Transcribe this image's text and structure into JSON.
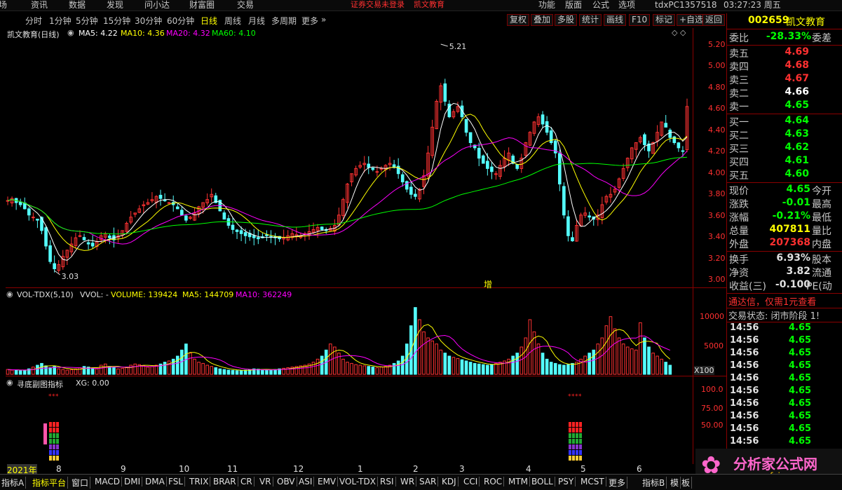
{
  "menu": {
    "items": [
      "场",
      "资讯",
      "数据",
      "发现",
      "问小达",
      "财富圈",
      "交易",
      "功能",
      "版面",
      "公式",
      "选项"
    ],
    "notice": "证券交易未登录",
    "stock_name": "凯文教育",
    "user": "tdxPC1357518",
    "time": "03:27:23 周五"
  },
  "toolbar": {
    "periods": [
      "分时",
      "1分钟",
      "5分钟",
      "15分钟",
      "30分钟",
      "60分钟",
      "日线",
      "周线",
      "月线",
      "多周期",
      "更多"
    ],
    "active": "日线",
    "more_arrow": "»",
    "right_buttons": [
      "复权",
      "叠加",
      "多股",
      "统计",
      "画线",
      "F10",
      "标记",
      "+自选",
      "返回"
    ]
  },
  "chart_header": {
    "title": "凯文教育(日线)",
    "ma5": "MA5: 4.22",
    "ma10": "MA10: 4.36",
    "ma20": "MA20: 4.32",
    "ma60": "MA60: 4.10",
    "high_label": "5.21",
    "low_label": "3.03",
    "center_mark": "增"
  },
  "price_axis": [
    "5.20",
    "5.00",
    "4.80",
    "4.60",
    "4.40",
    "4.20",
    "4.00",
    "3.80",
    "3.60",
    "3.40",
    "3.20",
    "3.00"
  ],
  "volume_header": {
    "title": "VOL-TDX(5,10)",
    "vvol": "VVOL: -",
    "volume": "VOLUME: 139424",
    "ma5": "MA5: 144709",
    "ma10": "MA10: 362249"
  },
  "volume_axis": [
    "10000",
    "5000",
    "X100"
  ],
  "indicator_header": {
    "title": "寻底副图指标",
    "xg": "XG: 0.00"
  },
  "indicator_axis": [
    "100.0",
    "75.00",
    "50.00"
  ],
  "dates": [
    "2021年",
    "8",
    "9",
    "10",
    "11",
    "12",
    "1",
    "2",
    "3",
    "4",
    "5",
    "6"
  ],
  "side": {
    "code": "002659",
    "name": "凯文教育",
    "weibi": {
      "label": "委比",
      "value": "-28.33%",
      "label2": "委差"
    },
    "asks": [
      {
        "label": "卖五",
        "price": "4.69"
      },
      {
        "label": "卖四",
        "price": "4.68"
      },
      {
        "label": "卖三",
        "price": "4.67"
      },
      {
        "label": "卖二",
        "price": "4.66"
      },
      {
        "label": "卖一",
        "price": "4.65"
      }
    ],
    "bids": [
      {
        "label": "买一",
        "price": "4.64"
      },
      {
        "label": "买二",
        "price": "4.63"
      },
      {
        "label": "买三",
        "price": "4.62"
      },
      {
        "label": "买四",
        "price": "4.61"
      },
      {
        "label": "买五",
        "price": "4.60"
      }
    ],
    "stats": [
      {
        "label": "现价",
        "value": "4.65",
        "label2": "今开",
        "color": "#00ff00"
      },
      {
        "label": "涨跌",
        "value": "-0.01",
        "label2": "最高",
        "color": "#00ff00"
      },
      {
        "label": "涨幅",
        "value": "-0.21%",
        "label2": "最低",
        "color": "#00ff00"
      },
      {
        "label": "总量",
        "value": "407811",
        "label2": "量比",
        "color": "#ffff00"
      },
      {
        "label": "外盘",
        "value": "207368",
        "label2": "内盘",
        "color": "#ff3030"
      }
    ],
    "stats2": [
      {
        "label": "换手",
        "value": "6.93%",
        "label2": "股本",
        "color": "#e0e0e0"
      },
      {
        "label": "净资",
        "value": "3.82",
        "label2": "流通",
        "color": "#e0e0e0"
      },
      {
        "label": "收益(三)",
        "value": "-0.100",
        "label2": "PE(动",
        "color": "#e0e0e0"
      }
    ],
    "promo": "通达信，仅需1元查看",
    "trade_status": "交易状态: 闭市阶段 1!",
    "ticks": [
      {
        "time": "14:56",
        "price": "4.65"
      },
      {
        "time": "14:56",
        "price": "4.65"
      },
      {
        "time": "14:56",
        "price": "4.65"
      },
      {
        "time": "14:56",
        "price": "4.65"
      },
      {
        "time": "14:56",
        "price": "4.65"
      },
      {
        "time": "14:56",
        "price": "4.65"
      },
      {
        "time": "14:56",
        "price": "4.65"
      },
      {
        "time": "14:56",
        "price": "4.65"
      },
      {
        "time": "14:56",
        "price": "4.65"
      },
      {
        "time": "14:56",
        "price": "4.65"
      }
    ]
  },
  "watermark": {
    "brand": "分析家公式网",
    "url": "www.fxjgsw.com"
  },
  "bottom_tabs": [
    "指标A",
    "指标平台",
    "窗口",
    "MACD",
    "DMI",
    "DMA",
    "FSL",
    "TRIX",
    "BRAR",
    "CR",
    "VR",
    "OBV",
    "ASI",
    "EMV",
    "VOL-TDX",
    "RSI",
    "WR",
    "SAR",
    "KDJ",
    "CCI",
    "ROC",
    "MTM",
    "BOLL",
    "PSY",
    "MCST",
    "更多",
    "指标B",
    "模",
    "板"
  ],
  "chart_data": {
    "type": "candlestick",
    "price_range": [
      2.9,
      5.3
    ],
    "series_colors": {
      "up": "#ff3232",
      "down": "#54ffff",
      "ma5": "#ffffff",
      "ma10": "#ffff00",
      "ma20": "#ff00ff",
      "ma60": "#00ff00"
    },
    "closes": [
      3.74,
      3.76,
      3.72,
      3.7,
      3.66,
      3.6,
      3.58,
      3.55,
      3.45,
      3.3,
      3.15,
      3.08,
      3.12,
      3.2,
      3.26,
      3.32,
      3.38,
      3.4,
      3.36,
      3.32,
      3.3,
      3.34,
      3.4,
      3.42,
      3.38,
      3.36,
      3.4,
      3.45,
      3.52,
      3.58,
      3.62,
      3.66,
      3.7,
      3.72,
      3.75,
      3.78,
      3.76,
      3.74,
      3.72,
      3.7,
      3.66,
      3.6,
      3.55,
      3.58,
      3.62,
      3.68,
      3.72,
      3.75,
      3.8,
      3.72,
      3.64,
      3.56,
      3.5,
      3.46,
      3.44,
      3.42,
      3.4,
      3.39,
      3.38,
      3.37,
      3.38,
      3.4,
      3.39,
      3.38,
      3.37,
      3.38,
      3.4,
      3.42,
      3.41,
      3.4,
      3.42,
      3.44,
      3.46,
      3.48,
      3.46,
      3.45,
      3.47,
      3.5,
      3.6,
      3.75,
      3.9,
      4.0,
      4.05,
      4.08,
      4.1,
      4.06,
      4.04,
      4.02,
      4.05,
      4.08,
      4.1,
      4.06,
      4.0,
      3.92,
      3.85,
      3.8,
      3.78,
      3.85,
      3.98,
      4.2,
      4.45,
      4.7,
      4.85,
      4.7,
      4.55,
      4.6,
      4.65,
      4.55,
      4.4,
      4.3,
      4.25,
      4.15,
      4.1,
      4.05,
      4.02,
      4.0,
      4.08,
      4.15,
      4.2,
      4.1,
      4.05,
      4.15,
      4.3,
      4.4,
      4.5,
      4.55,
      4.48,
      4.4,
      4.3,
      4.2,
      3.9,
      3.6,
      3.4,
      3.35,
      3.5,
      3.6,
      3.62,
      3.58,
      3.56,
      3.6,
      3.7,
      3.78,
      3.8,
      3.85,
      3.95,
      4.05,
      4.15,
      4.25,
      4.3,
      4.35,
      4.28,
      4.22,
      4.3,
      4.4,
      4.5,
      4.45,
      4.35,
      4.3,
      4.25,
      4.22,
      4.65
    ],
    "volumes": [
      800,
      700,
      750,
      600,
      650,
      900,
      1200,
      1500,
      1800,
      1400,
      1100,
      1300,
      900,
      800,
      700,
      750,
      900,
      1100,
      1300,
      1200,
      1000,
      900,
      1500,
      1700,
      1300,
      1100,
      900,
      1000,
      1200,
      1500,
      1700,
      1600,
      1400,
      1200,
      1300,
      1500,
      1700,
      2000,
      2200,
      2500,
      3000,
      4000,
      5000,
      3500,
      2500,
      2000,
      1800,
      1500,
      1300,
      1100,
      900,
      800,
      700,
      650,
      600,
      650,
      700,
      800,
      900,
      850,
      800,
      750,
      700,
      800,
      900,
      1000,
      1100,
      1200,
      1300,
      1400,
      1500,
      1700,
      2000,
      2500,
      3000,
      4000,
      5000,
      4500,
      3500,
      2500,
      2000,
      1800,
      1600,
      1500,
      1400,
      1300,
      1200,
      1100,
      1200,
      1300,
      1500,
      1800,
      2200,
      3000,
      5000,
      8000,
      11000,
      9000,
      7000,
      6000,
      5500,
      5000,
      4000,
      3500,
      3000,
      2800,
      2600,
      2400,
      2200,
      2000,
      1800,
      1700,
      1600,
      1500,
      1600,
      1800,
      2000,
      2200,
      2500,
      3000,
      3500,
      4500,
      6000,
      9000,
      7000,
      5000,
      3500,
      2500,
      2000,
      1800,
      1600,
      1500,
      1600,
      1800,
      2000,
      2500,
      3000,
      3500,
      4000,
      5000,
      6000,
      8000,
      9500,
      7500,
      6000,
      5000,
      4500,
      4200,
      4000,
      8500,
      6000,
      4500,
      3500,
      3000,
      2500,
      2000,
      1500
    ]
  }
}
